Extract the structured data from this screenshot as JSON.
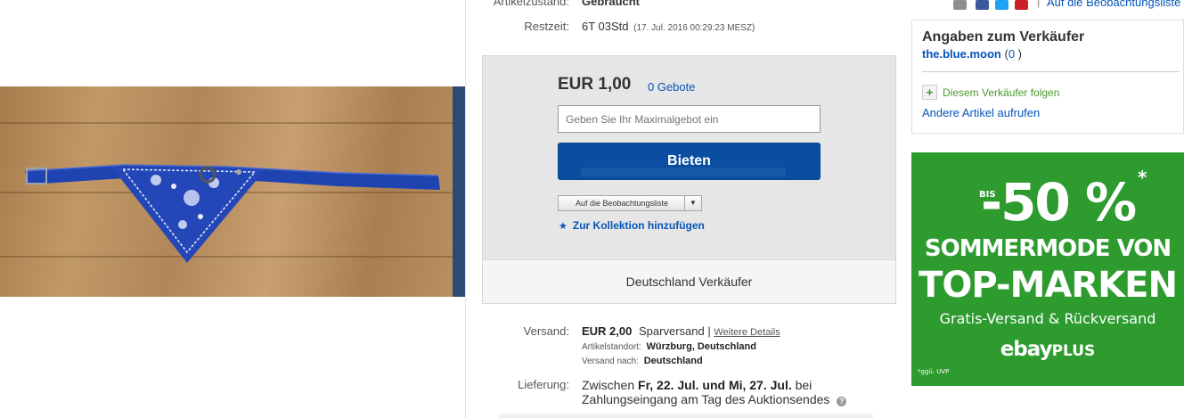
{
  "details": {
    "condition_label": "Artikelzustand:",
    "condition_value": "Gebraucht",
    "time_label": "Restzeit:",
    "time_value": "6T 03Std",
    "time_detail": "(17. Jul. 2016   00:29:23 MESZ)"
  },
  "bid": {
    "price": "EUR 1,00",
    "bids_count": "0 Gebote",
    "max_bid_placeholder": "Geben Sie Ihr Maximalgebot ein",
    "bid_button": "Bieten",
    "watchlist_button": "Auf die Beobachtungsliste",
    "collection_link": "Zur Kollektion hinzufügen",
    "seller_type": "Deutschland Verkäufer"
  },
  "shipping": {
    "label": "Versand:",
    "price": "EUR 2,00",
    "method": "Sparversand |",
    "more_details": "Weitere Details",
    "location_label": "Artikelstandort:",
    "location_value": "Würzburg, Deutschland",
    "ship_to_label": "Versand nach:",
    "ship_to_value": "Deutschland"
  },
  "delivery": {
    "label": "Lieferung:",
    "prefix": "Zwischen",
    "dates": "Fr, 22. Jul. und Mi, 27. Jul.",
    "suffix": "bei",
    "line2": "Zahlungseingang am Tag des Auktionsendes"
  },
  "top_links": {
    "watchlist": "Auf die Beobachtungsliste"
  },
  "seller": {
    "heading": "Angaben zum Verkäufer",
    "name": "the.blue.moon",
    "feedback_open": "(",
    "feedback_score": "0",
    "feedback_close": " )",
    "follow": "Diesem Verkäufer folgen",
    "other_items": "Andere Artikel aufrufen"
  },
  "ad": {
    "bis": "BIS",
    "discount": "-50 %",
    "asterisk": "*",
    "line1": "SOMMERMODE VON",
    "line2": "TOP-MARKEN",
    "line3": "Gratis-Versand & Rückversand",
    "brand": "ebay",
    "brand_suffix": "PLUS",
    "footnote": "*ggü. UVP"
  },
  "colors": {
    "link": "#0654ba",
    "bid_button": "#0b4ea1",
    "ad_green": "#2e9b2f",
    "follow_green": "#4a9a2a"
  }
}
